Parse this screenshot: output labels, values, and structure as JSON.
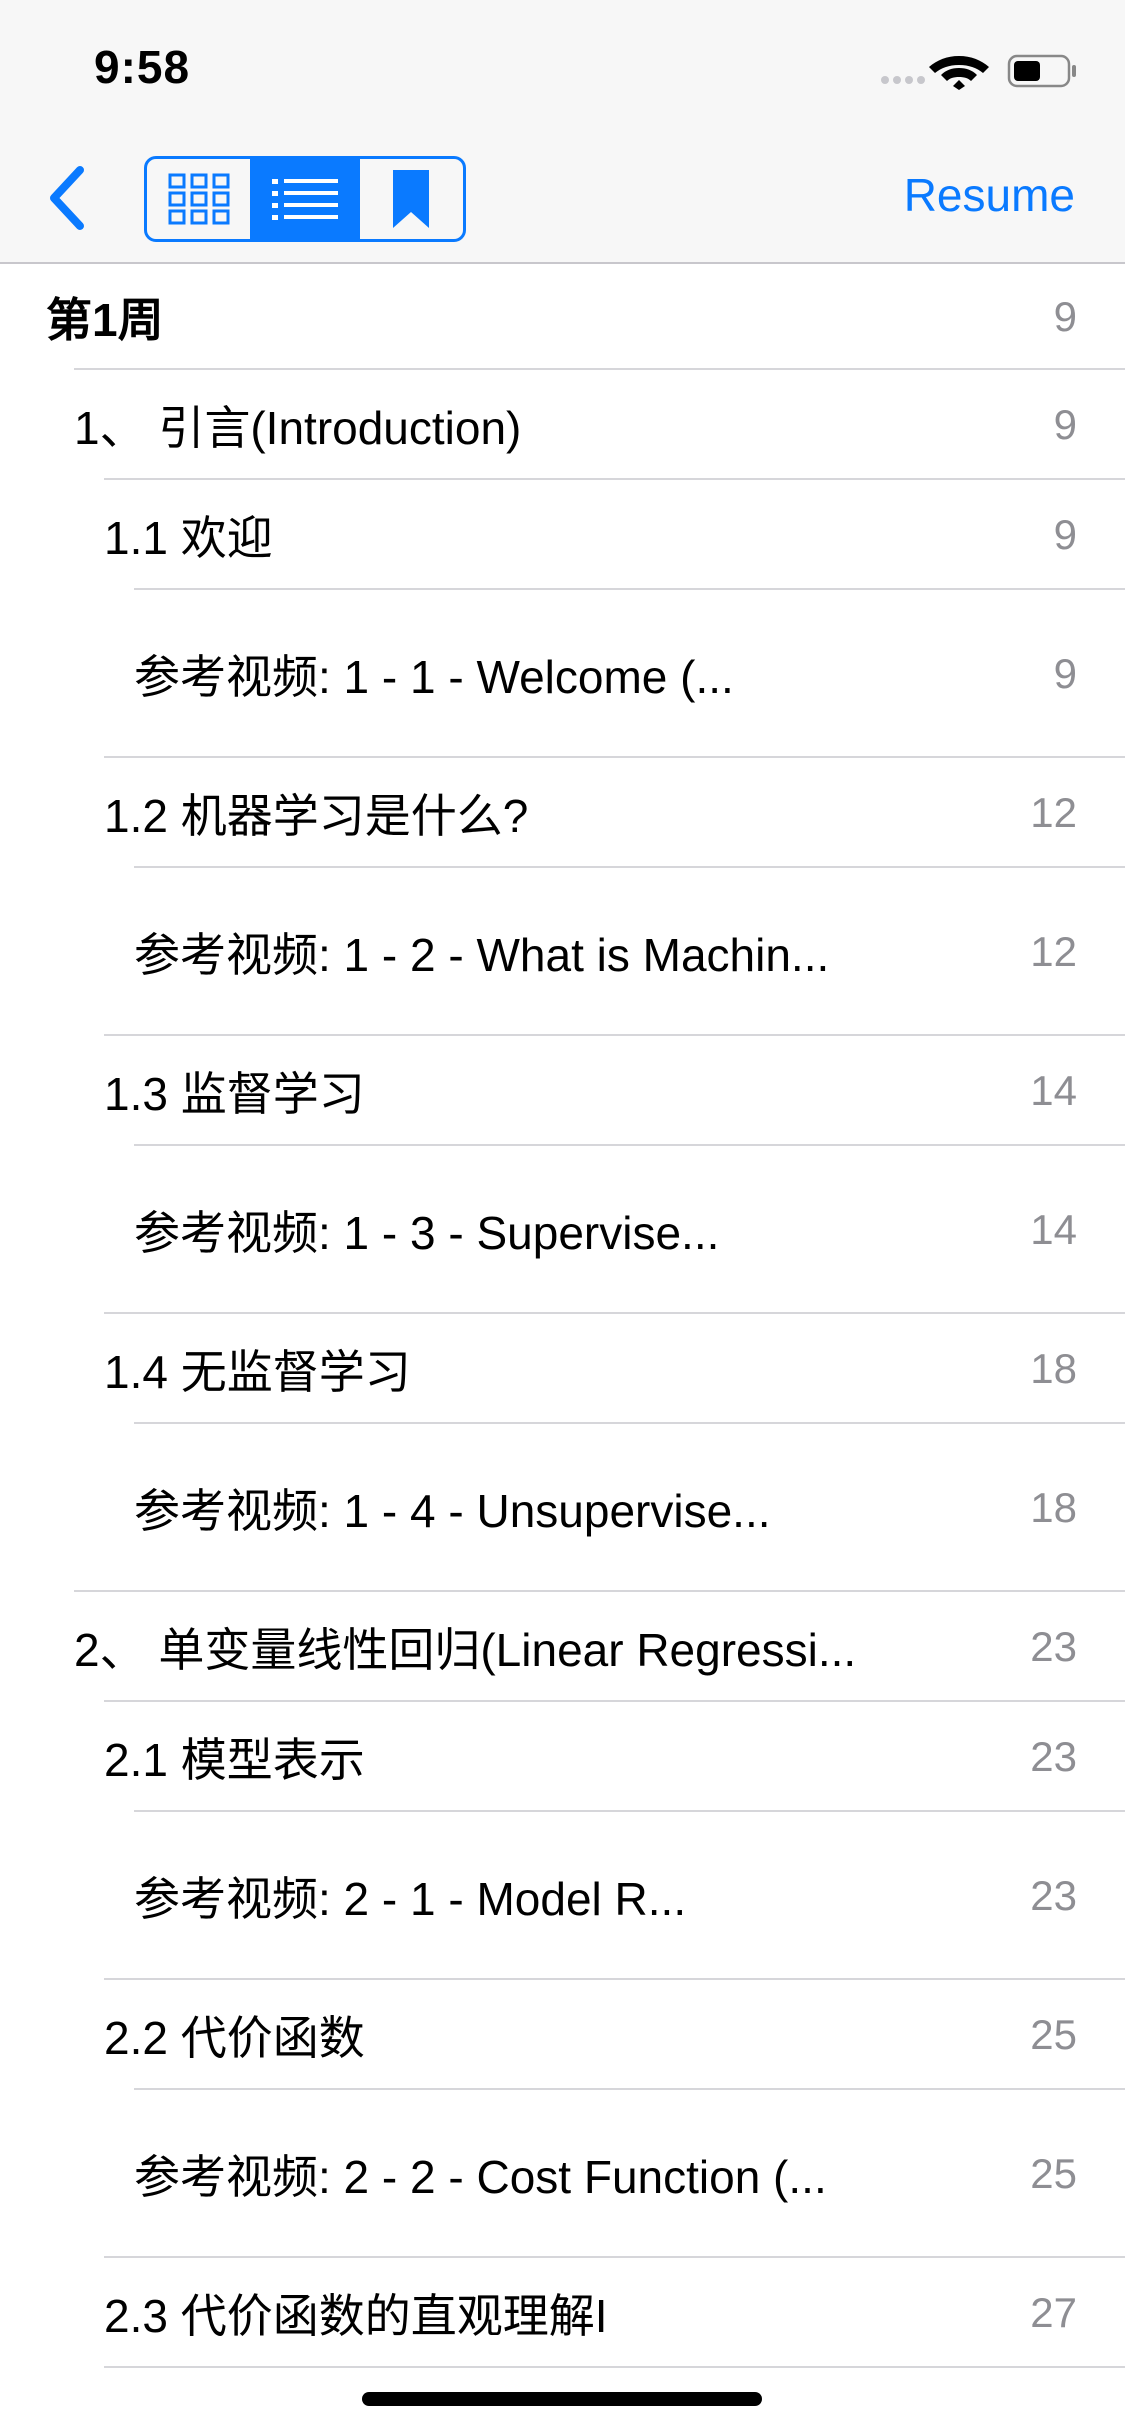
{
  "status_bar": {
    "time": "9:58"
  },
  "nav": {
    "resume_label": "Resume",
    "segments": [
      {
        "icon": "grid-icon",
        "selected": false
      },
      {
        "icon": "list-icon",
        "selected": true
      },
      {
        "icon": "bookmark-icon",
        "selected": false
      }
    ]
  },
  "colors": {
    "accent": "#0a7aff",
    "page_number": "#8e8e93",
    "separator": "#d6d6da"
  },
  "toc": [
    {
      "title": "第1周",
      "page": "9",
      "level": 0
    },
    {
      "title": "1、 引言(Introduction)",
      "page": "9",
      "level": 1
    },
    {
      "title": "1.1 欢迎",
      "page": "9",
      "level": 2
    },
    {
      "title": "参考视频: 1 - 1 - Welcome (...",
      "page": "9",
      "level": 3
    },
    {
      "title": "1.2 机器学习是什么?",
      "page": "12",
      "level": 2
    },
    {
      "title": "参考视频: 1 - 2 - What is Machin...",
      "page": "12",
      "level": 3
    },
    {
      "title": "1.3 监督学习",
      "page": "14",
      "level": 2
    },
    {
      "title": "参考视频: 1 - 3 - Supervise...",
      "page": "14",
      "level": 3
    },
    {
      "title": "1.4 无监督学习",
      "page": "18",
      "level": 2
    },
    {
      "title": "参考视频: 1 - 4 - Unsupervise...",
      "page": "18",
      "level": 3
    },
    {
      "title": "2、 单变量线性回归(Linear Regressi...",
      "page": "23",
      "level": 1
    },
    {
      "title": "2.1 模型表示",
      "page": "23",
      "level": 2
    },
    {
      "title": "参考视频: 2 - 1 - Model R...",
      "page": "23",
      "level": 3
    },
    {
      "title": "2.2 代价函数",
      "page": "25",
      "level": 2
    },
    {
      "title": "参考视频: 2 - 2 - Cost Function (...",
      "page": "25",
      "level": 3
    },
    {
      "title": "2.3 代价函数的直观理解I",
      "page": "27",
      "level": 2
    }
  ]
}
